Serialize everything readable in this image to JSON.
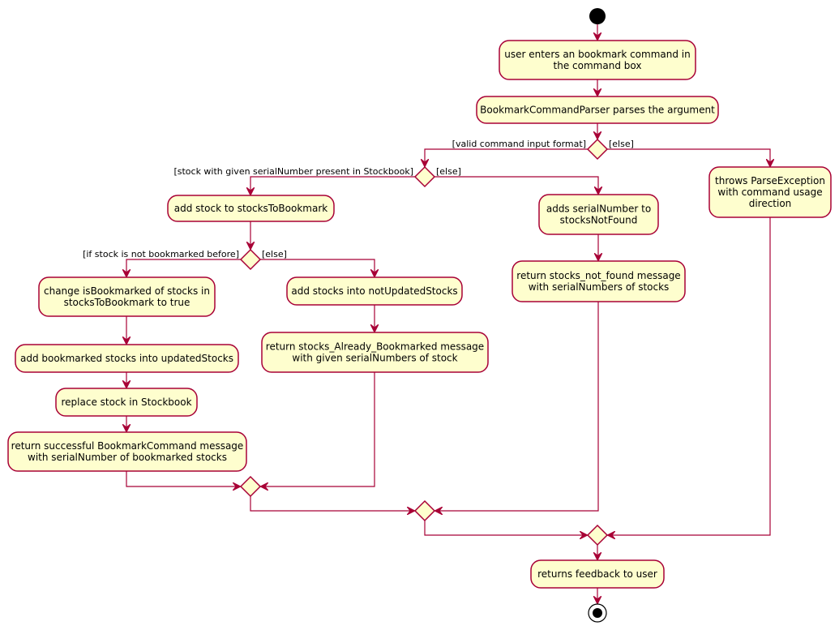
{
  "diagram": {
    "type": "uml-activity-diagram",
    "colors": {
      "node_fill": "#FEFECE",
      "border": "#A80036",
      "start_end": "#000000",
      "text": "#000000",
      "background": "#FFFFFF"
    },
    "start": {
      "label": "start"
    },
    "end": {
      "label": "end"
    },
    "activities": {
      "enter_command": [
        "user enters an bookmark command in",
        "the command box"
      ],
      "parse": [
        "BookmarkCommandParser parses the argument"
      ],
      "throws_exception": [
        "throws ParseException",
        "with command usage",
        "direction"
      ],
      "add_to_bookmark": [
        "add stock to stocksToBookmark"
      ],
      "adds_not_found": [
        "adds serialNumber to",
        "stocksNotFound"
      ],
      "return_not_found": [
        "return stocks_not_found message",
        "with serialNumbers of stocks"
      ],
      "change_bookmarked": [
        "change isBookmarked of stocks in",
        "stocksToBookmark to true"
      ],
      "add_updated": [
        "add bookmarked stocks into updatedStocks"
      ],
      "replace_stock": [
        "replace stock in Stockbook"
      ],
      "return_success": [
        "return successful BookmarkCommand message",
        "with serialNumber of bookmarked stocks"
      ],
      "add_not_updated": [
        "add stocks into notUpdatedStocks"
      ],
      "return_already": [
        "return stocks_Already_Bookmarked message",
        "with given serialNumbers of stock"
      ],
      "returns_feedback": [
        "returns feedback to user"
      ]
    },
    "guards": {
      "valid_format": "[valid command input format]",
      "valid_else": "[else]",
      "present": "[stock with given serialNumber present in Stockbook]",
      "present_else": "[else]",
      "not_bookmarked": "[if stock is not bookmarked before]",
      "not_bookmarked_else": "[else]"
    }
  }
}
